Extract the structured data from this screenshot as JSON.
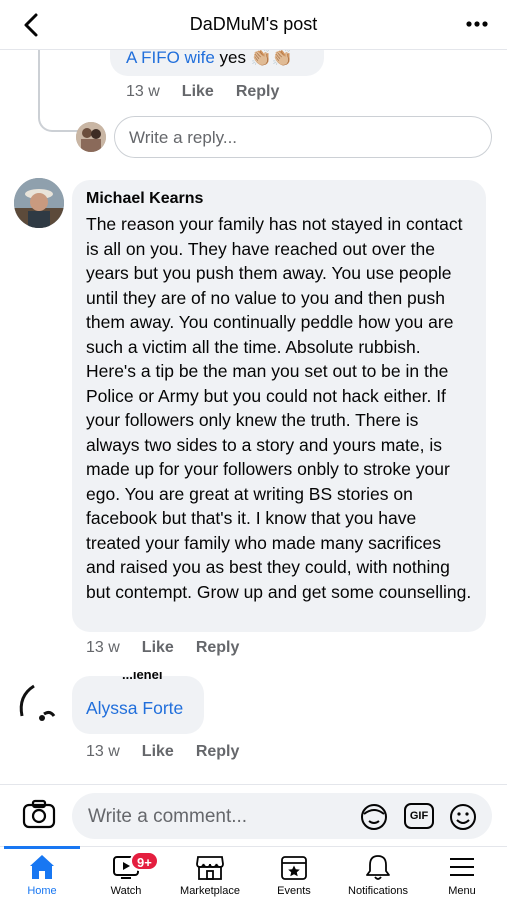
{
  "header": {
    "title": "DaDMuM's post"
  },
  "prev_reply": {
    "author": "A FIFO wife",
    "text": "yes",
    "emoji": "👏🏼👏🏼",
    "time": "13 w",
    "like": "Like",
    "reply": "Reply"
  },
  "reply_box": {
    "placeholder": "Write a reply..."
  },
  "comment": {
    "author": "Michael Kearns",
    "text": "The reason your family has not stayed in contact is all on you. They have reached out over the years but you push them away. You use people until they are of no value to you and then push them away. You continually peddle how you are such a victim all the time. Absolute rubbish. Here's a tip be the man you set out to be in the Police or Army but you could not hack either. If your followers only knew the truth. There is always two sides to a story and yours mate, is made up for your followers onbly to stroke your ego. You are great at writing BS stories on facebook but that's it.  I know that you have treated your family who made many sacrifices and raised you as best they could, with nothing but contempt. Grow up and get some counselling.",
    "time": "13 w",
    "like": "Like",
    "reply": "Reply"
  },
  "comment2": {
    "author_partial": "...ienel",
    "tag": "Alyssa Forte",
    "time": "13 w",
    "like": "Like",
    "reply": "Reply"
  },
  "composer": {
    "placeholder": "Write a comment...",
    "gif_label": "GIF"
  },
  "tabs": [
    {
      "label": "Home",
      "icon": "home-icon",
      "active": true
    },
    {
      "label": "Watch",
      "icon": "video-icon",
      "badge": "9+"
    },
    {
      "label": "Marketplace",
      "icon": "store-icon"
    },
    {
      "label": "Events",
      "icon": "calendar-star-icon"
    },
    {
      "label": "Notifications",
      "icon": "bell-icon"
    },
    {
      "label": "Menu",
      "icon": "hamburger-icon"
    }
  ],
  "colors": {
    "accent": "#1877f2",
    "link": "#216fdb",
    "bubble": "#f0f2f5",
    "badge": "#e41e3f"
  }
}
